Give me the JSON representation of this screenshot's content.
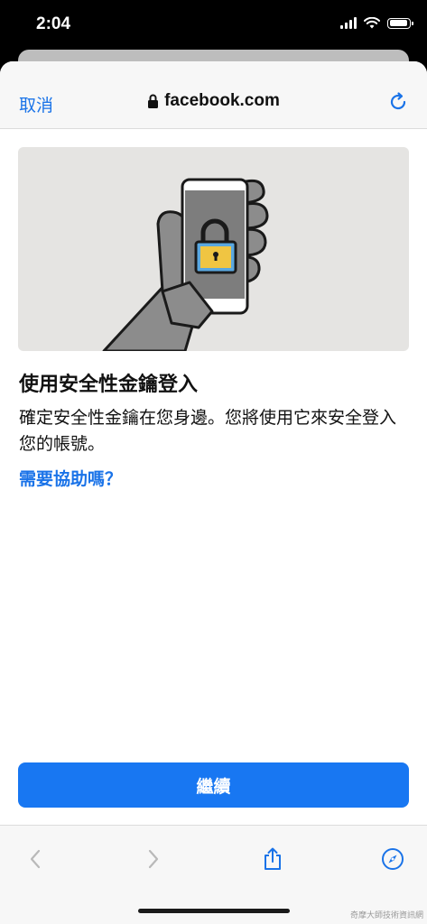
{
  "status_bar": {
    "time": "2:04"
  },
  "browser": {
    "cancel_label": "取消",
    "url": "facebook.com",
    "icons": {
      "lock": "lock-icon",
      "reload": "reload-icon"
    }
  },
  "content": {
    "title": "使用安全性金鑰登入",
    "description": "確定安全性金鑰在您身邊。您將使用它來安全登入您的帳號。",
    "help_link": "需要協助嗎？",
    "continue_label": "繼續"
  },
  "toolbar": {
    "icons": [
      "back-icon",
      "forward-icon",
      "share-icon",
      "compass-icon"
    ]
  },
  "watermark": "奇摩大師技術資訊網",
  "colors": {
    "link": "#1a73e8",
    "button": "#1877f2",
    "hero_bg": "#e5e4e2",
    "lock_yellow": "#f0c542",
    "lock_blue": "#5aa8e0"
  }
}
